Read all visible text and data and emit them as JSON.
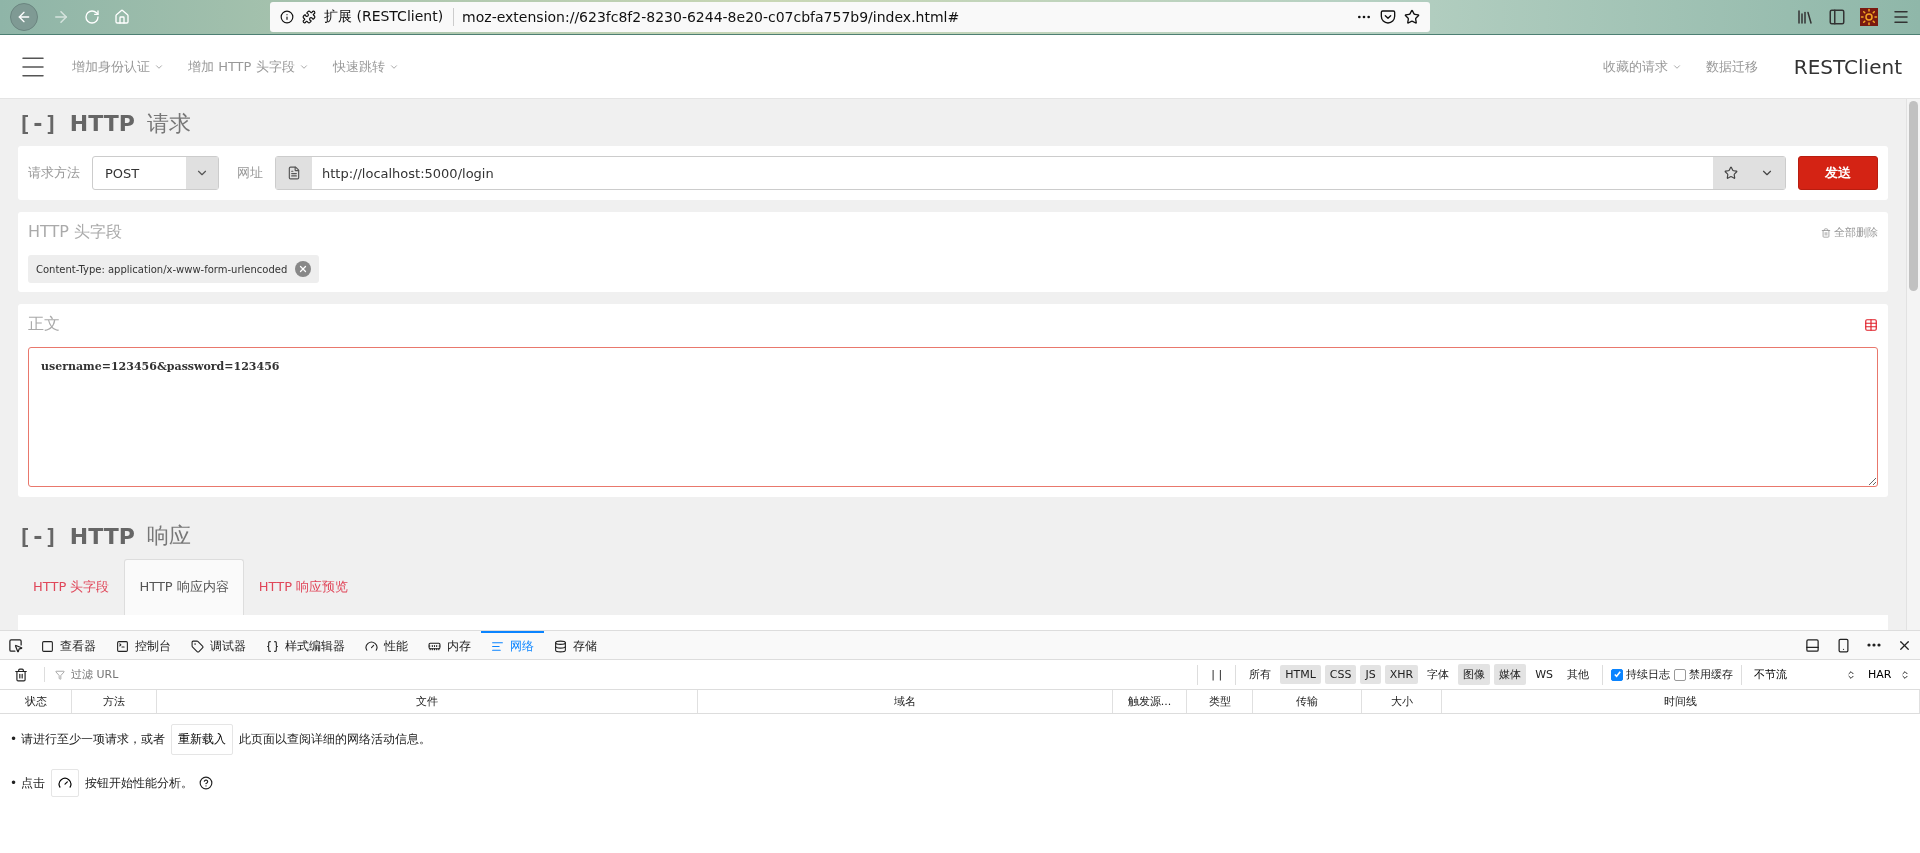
{
  "browser": {
    "site_label": "扩展 (RESTClient)",
    "url": "moz-extension://623fc8f2-8230-6244-8e20-c07cbfa757b9/index.html#"
  },
  "navbar": {
    "left_menus": [
      "增加身份认证",
      "增加 HTTP 头字段",
      "快速跳转"
    ],
    "right_menus": [
      {
        "label": "收藏的请求",
        "dropdown": true
      },
      {
        "label": "数据迁移",
        "dropdown": false
      }
    ],
    "brand": "RESTClient"
  },
  "request": {
    "toggle": "[-]",
    "title_bold": "HTTP",
    "title_rest": "请求",
    "method_label": "请求方法",
    "method": "POST",
    "url_label": "网址",
    "url": "http://localhost:5000/login",
    "send": "发送"
  },
  "headers": {
    "title": "HTTP 头字段",
    "delete_all": "全部删除",
    "tags": [
      "Content-Type: application/x-www-form-urlencoded"
    ]
  },
  "body": {
    "title": "正文",
    "value": "username=123456&password=123456"
  },
  "response": {
    "toggle": "[-]",
    "title_bold": "HTTP",
    "title_rest": "响应",
    "tabs": [
      {
        "label": "HTTP 头字段",
        "selected": false
      },
      {
        "label": "HTTP 响应内容",
        "selected": true
      },
      {
        "label": "HTTP 响应预览",
        "selected": false
      }
    ]
  },
  "devtools": {
    "tabs": [
      {
        "label": "查看器",
        "selected": false
      },
      {
        "label": "控制台",
        "selected": false
      },
      {
        "label": "调试器",
        "selected": false
      },
      {
        "label": "样式编辑器",
        "selected": false
      },
      {
        "label": "性能",
        "selected": false
      },
      {
        "label": "内存",
        "selected": false
      },
      {
        "label": "网络",
        "selected": true
      },
      {
        "label": "存储",
        "selected": false
      }
    ],
    "filter_placeholder": "过滤 URL",
    "pause": "| |",
    "filters": [
      {
        "label": "所有",
        "selected": false
      },
      {
        "label": "HTML",
        "selected": true
      },
      {
        "label": "CSS",
        "selected": true
      },
      {
        "label": "JS",
        "selected": true
      },
      {
        "label": "XHR",
        "selected": true
      },
      {
        "label": "字体",
        "selected": false
      },
      {
        "label": "图像",
        "selected": true
      },
      {
        "label": "媒体",
        "selected": true
      },
      {
        "label": "WS",
        "selected": false
      },
      {
        "label": "其他",
        "selected": false
      }
    ],
    "options": [
      {
        "label": "持续日志",
        "checked": true
      },
      {
        "label": "禁用缓存",
        "checked": false
      }
    ],
    "throttle": "不节流",
    "har": "HAR",
    "columns": [
      "状态",
      "方法",
      "文件",
      "域名",
      "触发源...",
      "类型",
      "传输",
      "大小",
      "时间线"
    ],
    "hint1_before": "• 请进行至少一项请求，或者",
    "reload": "重新载入",
    "hint1_after": "此页面以查阅详细的网络活动信息。",
    "hint2_before": "• 点击",
    "hint2_after": "按钮开始性能分析。"
  }
}
